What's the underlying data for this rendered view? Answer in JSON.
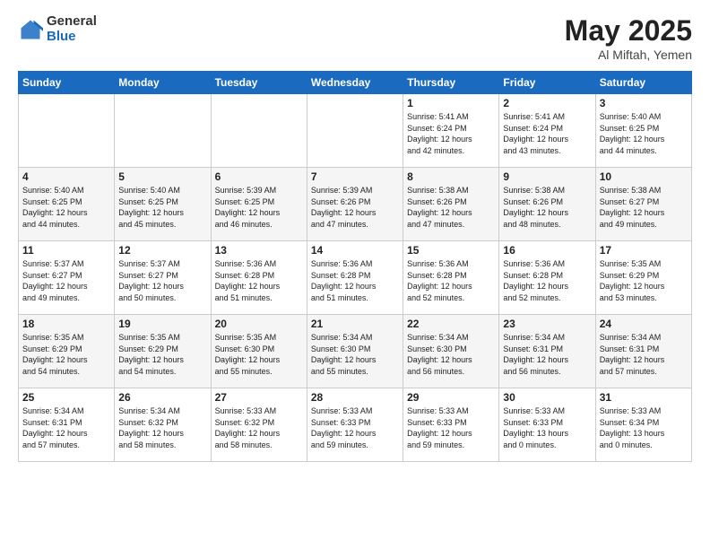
{
  "header": {
    "logo_general": "General",
    "logo_blue": "Blue",
    "month_title": "May 2025",
    "location": "Al Miftah, Yemen"
  },
  "days_of_week": [
    "Sunday",
    "Monday",
    "Tuesday",
    "Wednesday",
    "Thursday",
    "Friday",
    "Saturday"
  ],
  "weeks": [
    [
      {
        "day": "",
        "info": ""
      },
      {
        "day": "",
        "info": ""
      },
      {
        "day": "",
        "info": ""
      },
      {
        "day": "",
        "info": ""
      },
      {
        "day": "1",
        "info": "Sunrise: 5:41 AM\nSunset: 6:24 PM\nDaylight: 12 hours\nand 42 minutes."
      },
      {
        "day": "2",
        "info": "Sunrise: 5:41 AM\nSunset: 6:24 PM\nDaylight: 12 hours\nand 43 minutes."
      },
      {
        "day": "3",
        "info": "Sunrise: 5:40 AM\nSunset: 6:25 PM\nDaylight: 12 hours\nand 44 minutes."
      }
    ],
    [
      {
        "day": "4",
        "info": "Sunrise: 5:40 AM\nSunset: 6:25 PM\nDaylight: 12 hours\nand 44 minutes."
      },
      {
        "day": "5",
        "info": "Sunrise: 5:40 AM\nSunset: 6:25 PM\nDaylight: 12 hours\nand 45 minutes."
      },
      {
        "day": "6",
        "info": "Sunrise: 5:39 AM\nSunset: 6:25 PM\nDaylight: 12 hours\nand 46 minutes."
      },
      {
        "day": "7",
        "info": "Sunrise: 5:39 AM\nSunset: 6:26 PM\nDaylight: 12 hours\nand 47 minutes."
      },
      {
        "day": "8",
        "info": "Sunrise: 5:38 AM\nSunset: 6:26 PM\nDaylight: 12 hours\nand 47 minutes."
      },
      {
        "day": "9",
        "info": "Sunrise: 5:38 AM\nSunset: 6:26 PM\nDaylight: 12 hours\nand 48 minutes."
      },
      {
        "day": "10",
        "info": "Sunrise: 5:38 AM\nSunset: 6:27 PM\nDaylight: 12 hours\nand 49 minutes."
      }
    ],
    [
      {
        "day": "11",
        "info": "Sunrise: 5:37 AM\nSunset: 6:27 PM\nDaylight: 12 hours\nand 49 minutes."
      },
      {
        "day": "12",
        "info": "Sunrise: 5:37 AM\nSunset: 6:27 PM\nDaylight: 12 hours\nand 50 minutes."
      },
      {
        "day": "13",
        "info": "Sunrise: 5:36 AM\nSunset: 6:28 PM\nDaylight: 12 hours\nand 51 minutes."
      },
      {
        "day": "14",
        "info": "Sunrise: 5:36 AM\nSunset: 6:28 PM\nDaylight: 12 hours\nand 51 minutes."
      },
      {
        "day": "15",
        "info": "Sunrise: 5:36 AM\nSunset: 6:28 PM\nDaylight: 12 hours\nand 52 minutes."
      },
      {
        "day": "16",
        "info": "Sunrise: 5:36 AM\nSunset: 6:28 PM\nDaylight: 12 hours\nand 52 minutes."
      },
      {
        "day": "17",
        "info": "Sunrise: 5:35 AM\nSunset: 6:29 PM\nDaylight: 12 hours\nand 53 minutes."
      }
    ],
    [
      {
        "day": "18",
        "info": "Sunrise: 5:35 AM\nSunset: 6:29 PM\nDaylight: 12 hours\nand 54 minutes."
      },
      {
        "day": "19",
        "info": "Sunrise: 5:35 AM\nSunset: 6:29 PM\nDaylight: 12 hours\nand 54 minutes."
      },
      {
        "day": "20",
        "info": "Sunrise: 5:35 AM\nSunset: 6:30 PM\nDaylight: 12 hours\nand 55 minutes."
      },
      {
        "day": "21",
        "info": "Sunrise: 5:34 AM\nSunset: 6:30 PM\nDaylight: 12 hours\nand 55 minutes."
      },
      {
        "day": "22",
        "info": "Sunrise: 5:34 AM\nSunset: 6:30 PM\nDaylight: 12 hours\nand 56 minutes."
      },
      {
        "day": "23",
        "info": "Sunrise: 5:34 AM\nSunset: 6:31 PM\nDaylight: 12 hours\nand 56 minutes."
      },
      {
        "day": "24",
        "info": "Sunrise: 5:34 AM\nSunset: 6:31 PM\nDaylight: 12 hours\nand 57 minutes."
      }
    ],
    [
      {
        "day": "25",
        "info": "Sunrise: 5:34 AM\nSunset: 6:31 PM\nDaylight: 12 hours\nand 57 minutes."
      },
      {
        "day": "26",
        "info": "Sunrise: 5:34 AM\nSunset: 6:32 PM\nDaylight: 12 hours\nand 58 minutes."
      },
      {
        "day": "27",
        "info": "Sunrise: 5:33 AM\nSunset: 6:32 PM\nDaylight: 12 hours\nand 58 minutes."
      },
      {
        "day": "28",
        "info": "Sunrise: 5:33 AM\nSunset: 6:33 PM\nDaylight: 12 hours\nand 59 minutes."
      },
      {
        "day": "29",
        "info": "Sunrise: 5:33 AM\nSunset: 6:33 PM\nDaylight: 12 hours\nand 59 minutes."
      },
      {
        "day": "30",
        "info": "Sunrise: 5:33 AM\nSunset: 6:33 PM\nDaylight: 13 hours\nand 0 minutes."
      },
      {
        "day": "31",
        "info": "Sunrise: 5:33 AM\nSunset: 6:34 PM\nDaylight: 13 hours\nand 0 minutes."
      }
    ]
  ]
}
